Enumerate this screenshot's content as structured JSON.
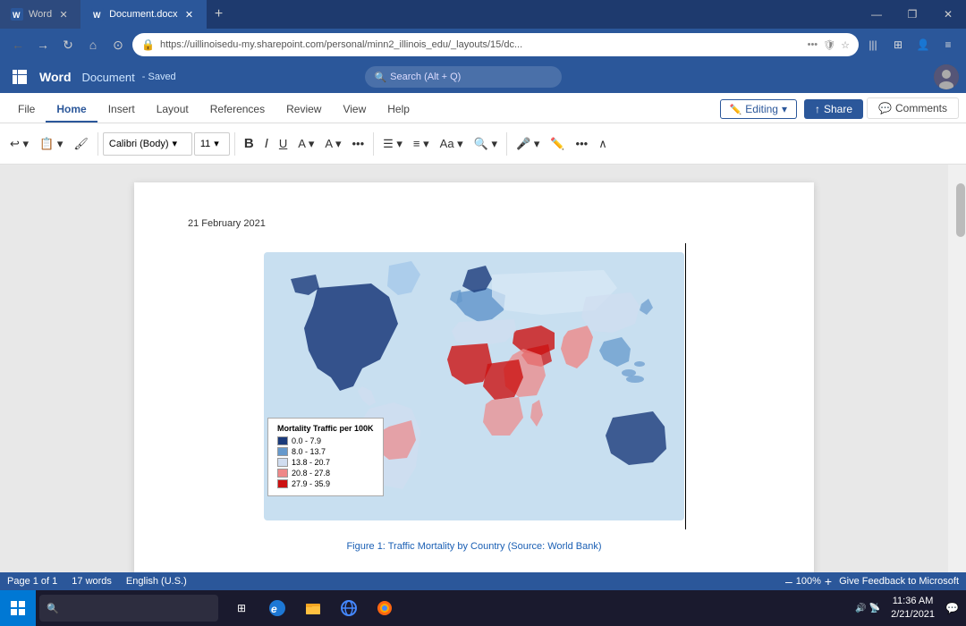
{
  "titlebar": {
    "tabs": [
      {
        "id": "word-tab",
        "label": "Word",
        "icon": "W",
        "active": false
      },
      {
        "id": "doc-tab",
        "label": "Document.docx",
        "icon": "W",
        "active": true
      }
    ],
    "controls": {
      "minimize": "—",
      "restore": "❐",
      "close": "✕"
    }
  },
  "browserbar": {
    "url": "https://uillinoisedu-my.sharepoint.com/personal/minn2_illinois_edu/_layouts/15/dc...",
    "nav": {
      "back": "←",
      "forward": "→",
      "refresh": "↻",
      "home": "⌂",
      "history": "⊙"
    }
  },
  "appbar": {
    "appName": "Word",
    "docName": "Document",
    "saved": "- Saved",
    "searchPlaceholder": "Search (Alt + Q)"
  },
  "ribbonTabs": [
    {
      "id": "file",
      "label": "File",
      "active": false
    },
    {
      "id": "home",
      "label": "Home",
      "active": true
    },
    {
      "id": "insert",
      "label": "Insert",
      "active": false
    },
    {
      "id": "layout",
      "label": "Layout",
      "active": false
    },
    {
      "id": "references",
      "label": "References",
      "active": false
    },
    {
      "id": "review",
      "label": "Review",
      "active": false
    },
    {
      "id": "view",
      "label": "View",
      "active": false
    },
    {
      "id": "help",
      "label": "Help",
      "active": false
    }
  ],
  "editingButton": "Editing",
  "shareButton": "Share",
  "commentsButton": "Comments",
  "toolbar": {
    "fontName": "Calibri (Body)",
    "fontSize": "11",
    "bold": "B",
    "italic": "I",
    "underline": "U"
  },
  "document": {
    "date": "21 February 2021",
    "figureCaption": "Figure 1: Traffic Mortality by Country (Source: World Bank)",
    "mapAlt": "World map showing traffic mortality per 100K by country"
  },
  "legend": {
    "title": "Mortality Traffic per 100K",
    "items": [
      {
        "range": "0.0 - 7.9",
        "color": "#1a3a7a"
      },
      {
        "range": "8.0 - 13.7",
        "color": "#6699cc"
      },
      {
        "range": "13.8 - 20.7",
        "color": "#d0ddf0"
      },
      {
        "range": "20.8 - 27.8",
        "color": "#ee8888"
      },
      {
        "range": "27.9 - 35.9",
        "color": "#cc1111"
      }
    ]
  },
  "statusbar": {
    "page": "Page 1 of 1",
    "words": "17 words",
    "language": "English (U.S.)",
    "zoom": "100%",
    "feedback": "Give Feedback to Microsoft",
    "zoomMinus": "–",
    "zoomPlus": "+"
  },
  "taskbar": {
    "time": "11:36 AM",
    "date": "2/21/2021",
    "searchPlaceholder": "🔍"
  }
}
